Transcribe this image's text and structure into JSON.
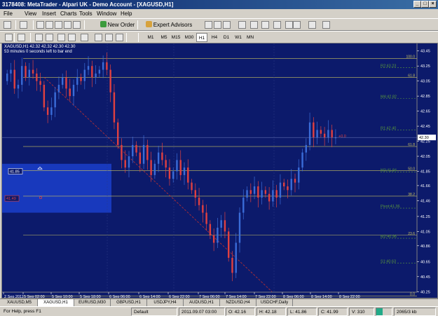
{
  "window": {
    "title": "3178408: MetaTrader - Alpari UK - Demo Account - [XAGUSD,H1]"
  },
  "menu": [
    "File",
    "View",
    "Insert",
    "Charts",
    "Tools",
    "Window",
    "Help"
  ],
  "toolbar": {
    "new_order": "New Order",
    "expert_advisors": "Expert Advisors",
    "timeframes": [
      "M1",
      "M5",
      "M15",
      "M30",
      "H1",
      "H4",
      "D1",
      "W1",
      "MN"
    ],
    "active_timeframe": "H1"
  },
  "chart": {
    "info_line": "XAGUSD,H1  42.32 42.32 42.30 42.30",
    "timer": "53 minutes 0 seconds left to bar end",
    "box_label_upper": "41.85",
    "box_label_lower": "41.49",
    "marker_label": "+0.0",
    "current_price": "42.30",
    "colors": {
      "background": "#0c1a6b",
      "bull": "#3a6cd8",
      "bear": "#e04040",
      "fib": "#c8c060",
      "pivot": "#5a9a3a",
      "box": "#1c44d8"
    }
  },
  "price_axis": [
    "43.45",
    "43.25",
    "43.05",
    "42.85",
    "42.65",
    "42.45",
    "42.25",
    "42.05",
    "41.85",
    "41.66",
    "41.46",
    "41.25",
    "41.05",
    "40.86",
    "40.65",
    "40.45",
    "40.25"
  ],
  "fib_labels": [
    "100.0",
    "61.8",
    "61.8",
    "50.0",
    "38.2",
    "23.6",
    "0.0"
  ],
  "level_labels": [
    "R2:43.23",
    "R1:42.40",
    "M4:42.82",
    "M3:41.84",
    "Pivot:41.36",
    "M2:40.96",
    "S1:40.63"
  ],
  "time_axis": [
    "2 Sep 2011",
    "5 Sep 02:00",
    "5 Sep 10:00",
    "5 Sep 18:00",
    "6 Sep 06:00",
    "6 Sep 14:00",
    "6 Sep 22:00",
    "7 Sep 06:00",
    "7 Sep 14:00",
    "7 Sep 22:00",
    "8 Sep 06:00",
    "8 Sep 14:00",
    "8 Sep 22:00"
  ],
  "tabs": [
    "XAUUSD,M5",
    "XAGUSD,H1",
    "EURUSD,M30",
    "GBPUSD,H1",
    "USDJPY,H4",
    "AUDUSD,H1",
    "NZDUSD,H4",
    "USDCHF,Daily"
  ],
  "active_tab": 1,
  "status": {
    "help": "For Help, press F1",
    "profile": "Default",
    "datetime": "2011.09.07 03:00",
    "open": "O: 42.16",
    "high": "H: 42.18",
    "low": "L: 41.86",
    "close": "C: 41.99",
    "volume": "V: 310",
    "traffic": "2065/3 kb"
  }
}
